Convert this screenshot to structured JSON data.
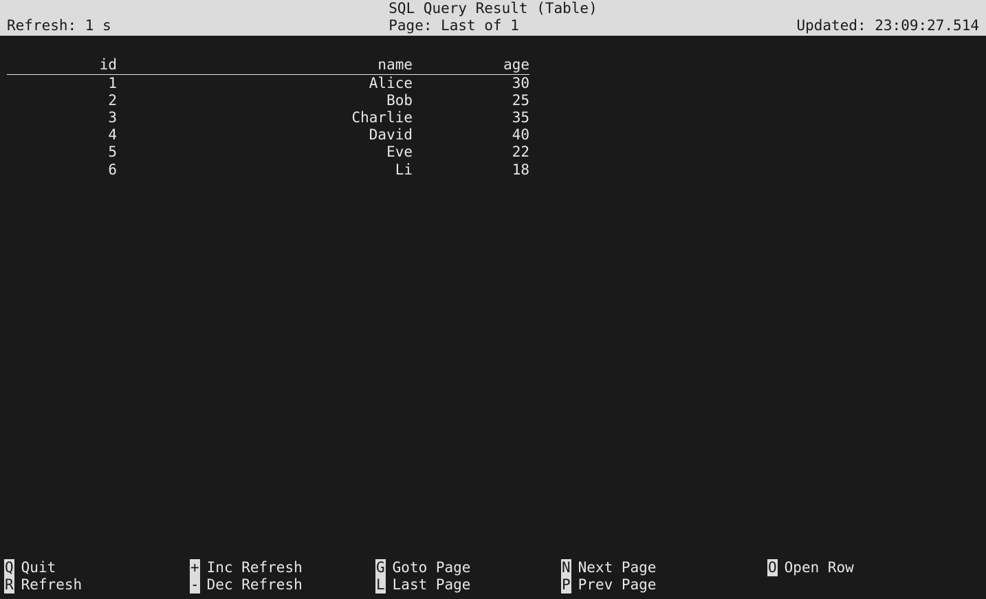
{
  "header": {
    "title": "SQL Query Result (Table)",
    "refresh_label": "Refresh: 1 s",
    "page_label": "Page: Last of 1",
    "updated_label": "Updated: 23:09:27.514"
  },
  "table": {
    "columns": [
      "id",
      "name",
      "age"
    ],
    "rows": [
      {
        "id": "1",
        "name": "Alice",
        "age": "30"
      },
      {
        "id": "2",
        "name": "Bob",
        "age": "25"
      },
      {
        "id": "3",
        "name": "Charlie",
        "age": "35"
      },
      {
        "id": "4",
        "name": "David",
        "age": "40"
      },
      {
        "id": "5",
        "name": "Eve",
        "age": "22"
      },
      {
        "id": "6",
        "name": "Li",
        "age": "18"
      }
    ]
  },
  "footer": {
    "row1": [
      {
        "key": "Q",
        "label": "Quit"
      },
      {
        "key": "+",
        "label": "Inc Refresh"
      },
      {
        "key": "G",
        "label": "Goto Page"
      },
      {
        "key": "N",
        "label": "Next Page"
      },
      {
        "key": "O",
        "label": "Open Row"
      }
    ],
    "row2": [
      {
        "key": "R",
        "label": "Refresh"
      },
      {
        "key": "-",
        "label": "Dec Refresh"
      },
      {
        "key": "L",
        "label": "Last Page"
      },
      {
        "key": "P",
        "label": "Prev Page"
      }
    ]
  }
}
